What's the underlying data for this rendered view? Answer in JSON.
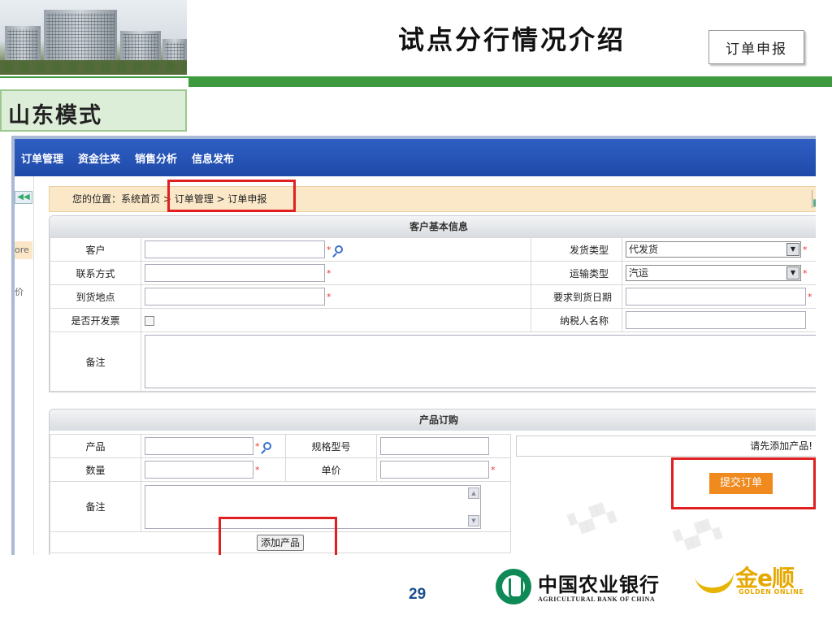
{
  "slide": {
    "title": "试点分行情况介绍",
    "tag": "订单申报",
    "mode": "山东模式",
    "page_number": "29"
  },
  "nav": {
    "items": [
      "订单管理",
      "资金往来",
      "销售分析",
      "信息发布"
    ]
  },
  "leftcol": {
    "more": "ore",
    "price": "价"
  },
  "breadcrumb": {
    "prefix": "您的位置：系统首页",
    "path": "> 订单管理 > 订单申报"
  },
  "customer_panel": {
    "title": "客户基本信息",
    "customer_label": "客户",
    "contact_label": "联系方式",
    "address_label": "到货地点",
    "invoice_label": "是否开发票",
    "remark_label": "备注",
    "delivery_type_label": "发货类型",
    "delivery_type_value": "代发货",
    "transport_type_label": "运输类型",
    "transport_type_value": "汽运",
    "arrival_date_label": "要求到货日期",
    "taxpayer_label": "纳税人名称"
  },
  "product_panel": {
    "title": "产品订购",
    "product_label": "产品",
    "spec_label": "规格型号",
    "qty_label": "数量",
    "price_label": "单价",
    "remark_label": "备注",
    "add_button": "添加产品",
    "hint": "请先添加产品!",
    "submit_button": "提交订单"
  },
  "footer": {
    "bank_cn": "中国农业银行",
    "bank_en": "AGRICULTURAL BANK OF CHINA",
    "brand_cn": "金e顺",
    "brand_en": "GOLDEN ONLINE"
  },
  "colors": {
    "accent_green": "#3e9a3e",
    "nav_blue": "#1f4aa8",
    "highlight_red": "#e02020",
    "submit_orange": "#f08a1e"
  }
}
